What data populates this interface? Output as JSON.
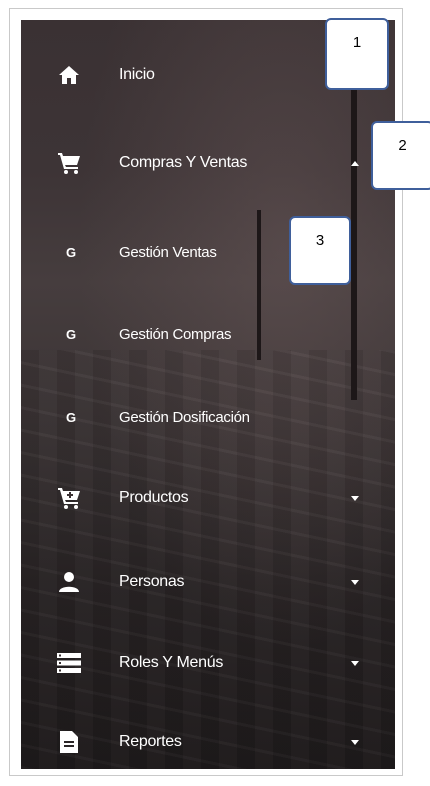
{
  "menu": {
    "items": [
      {
        "label": "Inicio",
        "icon": "home-icon"
      },
      {
        "label": "Compras Y Ventas",
        "icon": "cart-icon",
        "expanded": true
      },
      {
        "label": "Productos",
        "icon": "cart-plus-icon"
      },
      {
        "label": "Personas",
        "icon": "person-icon"
      },
      {
        "label": "Roles Y Menús",
        "icon": "list-icon"
      },
      {
        "label": "Reportes",
        "icon": "document-icon"
      }
    ],
    "submenu": [
      {
        "letter": "G",
        "label": "Gestión Ventas"
      },
      {
        "letter": "G",
        "label": "Gestión Compras"
      },
      {
        "letter": "G",
        "label": "Gestión Dosificación"
      }
    ]
  },
  "callouts": [
    "1",
    "2",
    "3"
  ]
}
